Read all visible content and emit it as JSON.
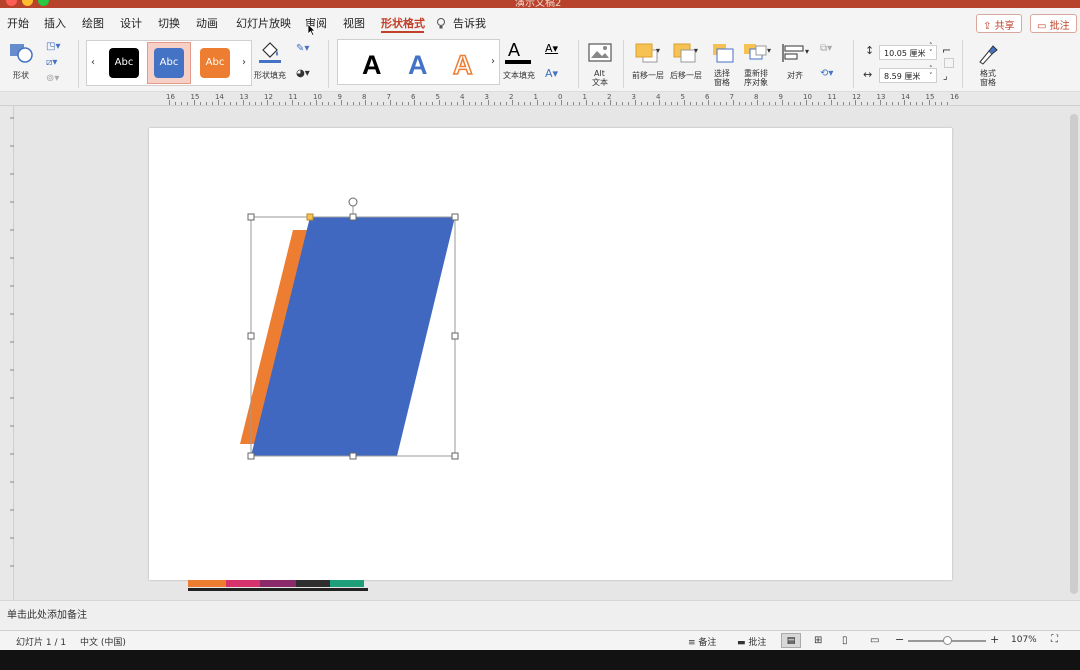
{
  "window": {
    "title": "演示文稿2"
  },
  "tabs": [
    {
      "label": "开始"
    },
    {
      "label": "插入"
    },
    {
      "label": "绘图"
    },
    {
      "label": "设计"
    },
    {
      "label": "切换"
    },
    {
      "label": "动画"
    },
    {
      "label": "幻灯片放映"
    },
    {
      "label": "审阅"
    },
    {
      "label": "视图"
    },
    {
      "label": "形状格式"
    },
    {
      "label": "告诉我"
    }
  ],
  "active_tab": "形状格式",
  "header": {
    "share": "共享",
    "comments": "批注"
  },
  "ribbon": {
    "shape_label": "形状",
    "style_swatches": [
      {
        "label": "Abc",
        "color": "#000000"
      },
      {
        "label": "Abc",
        "color": "#4472c4"
      },
      {
        "label": "Abc",
        "color": "#ed7d31"
      }
    ],
    "shape_fill": "形状填充",
    "wordart_letters": [
      {
        "char": "A",
        "color": "#000000"
      },
      {
        "char": "A",
        "color": "#4472c4"
      },
      {
        "char": "A",
        "color": "#ed7d31"
      }
    ],
    "text_fill": "文本填充",
    "alt_text_1": "Alt",
    "alt_text_2": "文本",
    "bring_forward": "前移一层",
    "send_backward": "后移一层",
    "selection_pane_1": "选择",
    "selection_pane_2": "窗格",
    "reorder_1": "重新排",
    "reorder_2": "序对象",
    "align": "对齐",
    "height_value": "10.05 厘米",
    "width_value": "8.59 厘米",
    "format_pane_1": "格式",
    "format_pane_2": "窗格"
  },
  "ruler": {
    "numbers": [
      "16",
      "15",
      "14",
      "13",
      "12",
      "11",
      "10",
      "9",
      "8",
      "7",
      "6",
      "5",
      "4",
      "3",
      "2",
      "1",
      "0",
      "1",
      "2",
      "3",
      "4",
      "5",
      "6",
      "7",
      "8",
      "9",
      "10",
      "11",
      "12",
      "13",
      "14",
      "15",
      "16"
    ]
  },
  "slide": {
    "shapes": [
      {
        "name": "orange-parallelogram",
        "color": "#ed7d31"
      },
      {
        "name": "blue-parallelogram",
        "color": "#4068c0"
      }
    ]
  },
  "notes": {
    "placeholder": "单击此处添加备注"
  },
  "status": {
    "slide_counter": "幻灯片 1 / 1",
    "language": "中文 (中国)",
    "notes_btn": "备注",
    "comments_btn": "批注",
    "zoom": "107%"
  },
  "colors": {
    "accent": "#c2412a",
    "titlebar": "#b8432c"
  }
}
